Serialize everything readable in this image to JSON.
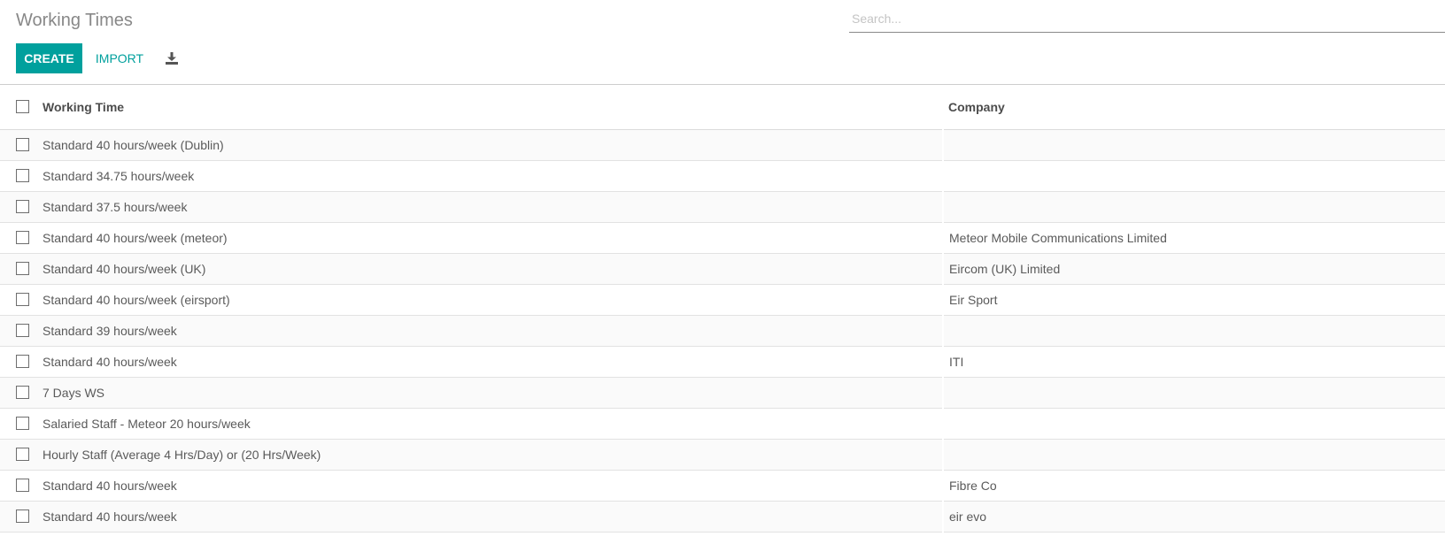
{
  "header": {
    "title": "Working Times",
    "search_placeholder": "Search...",
    "create_label": "CREATE",
    "import_label": "IMPORT",
    "download_icon": "download-icon"
  },
  "colors": {
    "accent": "#00a09d"
  },
  "table": {
    "columns": [
      "Working Time",
      "Company"
    ],
    "rows": [
      {
        "working_time": "Standard 40 hours/week (Dublin)",
        "company": ""
      },
      {
        "working_time": "Standard 34.75 hours/week",
        "company": ""
      },
      {
        "working_time": "Standard 37.5 hours/week",
        "company": ""
      },
      {
        "working_time": "Standard 40 hours/week (meteor)",
        "company": "Meteor Mobile Communications Limited"
      },
      {
        "working_time": "Standard 40 hours/week (UK)",
        "company": "Eircom (UK) Limited"
      },
      {
        "working_time": "Standard 40 hours/week (eirsport)",
        "company": "Eir Sport"
      },
      {
        "working_time": "Standard 39 hours/week",
        "company": ""
      },
      {
        "working_time": "Standard 40 hours/week",
        "company": "ITI"
      },
      {
        "working_time": "7 Days WS",
        "company": ""
      },
      {
        "working_time": "Salaried Staff - Meteor 20 hours/week",
        "company": ""
      },
      {
        "working_time": "Hourly Staff (Average 4 Hrs/Day) or (20 Hrs/Week)",
        "company": ""
      },
      {
        "working_time": "Standard 40 hours/week",
        "company": "Fibre Co"
      },
      {
        "working_time": "Standard 40 hours/week",
        "company": "eir evo"
      }
    ]
  }
}
